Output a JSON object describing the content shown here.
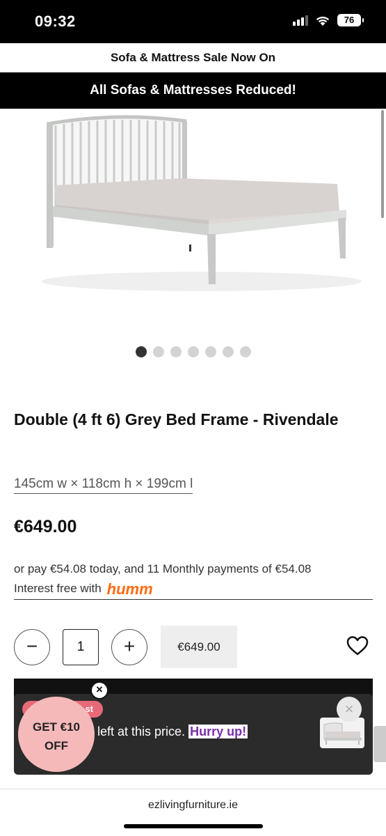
{
  "status_bar": {
    "time": "09:32",
    "battery": "76"
  },
  "promo": {
    "top_text": "Sofa & Mattress Sale Now On",
    "black_text": "All Sofas & Mattresses Reduced!"
  },
  "carousel": {
    "total_images": 7,
    "active_index": 0
  },
  "product": {
    "title": "Double (4 ft 6) Grey Bed Frame - Rivendale",
    "dimensions": "145cm w × 118cm h × 199cm l",
    "price": "€649.00"
  },
  "finance": {
    "line1": "or pay €54.08 today, and 11 Monthly payments of €54.08",
    "line2": "Interest free with",
    "brand": "humm"
  },
  "quantity": {
    "minus_label": "−",
    "value": "1",
    "plus_label": "+",
    "line_price": "€649.00"
  },
  "popup": {
    "tag_text": "st",
    "message": "left at this price.",
    "hurry": "Hurry up!",
    "close": "×"
  },
  "offer": {
    "line1": "GET €10",
    "line2": "OFF",
    "close": "×"
  },
  "browser": {
    "url": "ezlivingfurniture.ie"
  }
}
